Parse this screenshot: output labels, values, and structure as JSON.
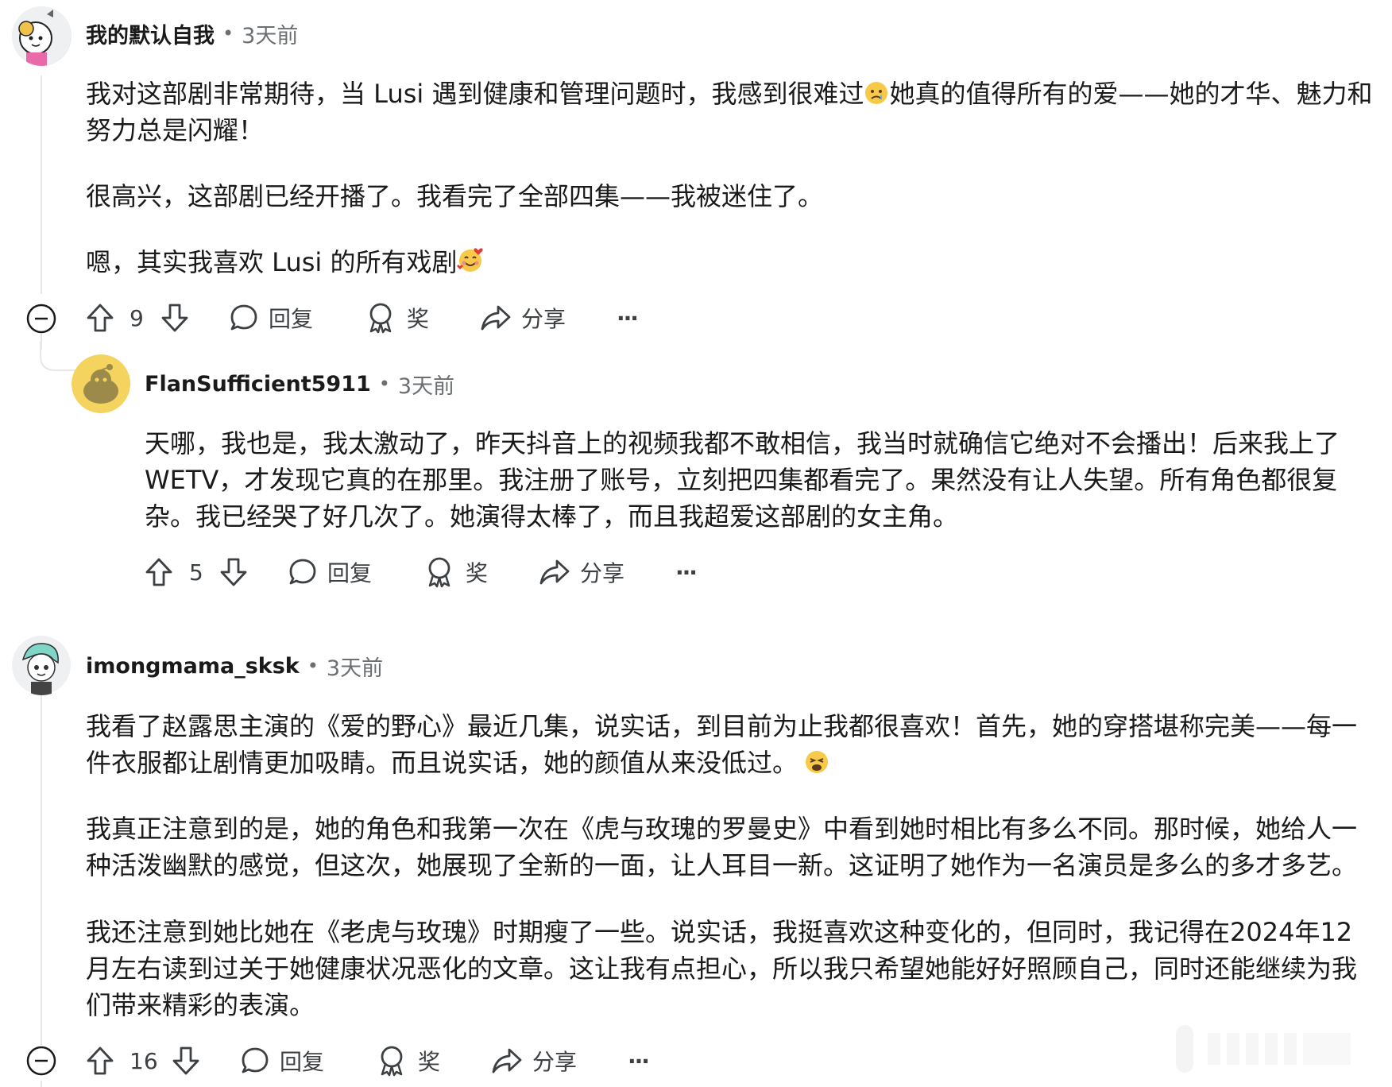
{
  "comments": [
    {
      "username": "我的默认自我",
      "separator": "•",
      "time": "3天前",
      "paragraphs": [
        [
          "我对这部剧非常期待，当 Lusi 遇到健康和管理问题时，我感到很难过",
          "她真的值得所有的爱——她的才华、魅力和"
        ],
        [
          "努力总是闪耀！"
        ],
        [
          "很高兴，这部剧已经开播了。我看完了全部四集——我被迷住了。"
        ],
        [
          "嗯，其实我喜欢 Lusi 的所有戏剧"
        ]
      ],
      "emojis": [
        "crying-face-emoji",
        "smiling-face-with-hearts-emoji"
      ],
      "votes": "9",
      "actions": {
        "reply": "回复",
        "award": "奖",
        "share": "分享",
        "more": "···"
      }
    },
    {
      "username": "FlanSufficient5911",
      "separator": "•",
      "time": "3天前",
      "paragraphs": [
        [
          "天哪，我也是，我太激动了，昨天抖音上的视频我都不敢相信，我当时就确信它绝对不会播出！后来我上了"
        ],
        [
          "WETV，才发现它真的在那里。我注册了账号，立刻把四集都看完了。果然没有让人失望。所有角色都很复"
        ],
        [
          "杂。我已经哭了好几次了。她演得太棒了，而且我超爱这部剧的女主角。"
        ]
      ],
      "votes": "5",
      "actions": {
        "reply": "回复",
        "award": "奖",
        "share": "分享",
        "more": "···"
      }
    },
    {
      "username": "imongmama_sksk",
      "separator": "•",
      "time": "3天前",
      "paragraphs": [
        [
          "我看了赵露思主演的《爱的野心》最近几集，说实话，到目前为止我都很喜欢！首先，她的穿搭堪称完美——每一"
        ],
        [
          "件衣服都让剧情更加吸睛。而且说实话，她的颜值从来没低过。"
        ],
        [
          "我真正注意到的是，她的角色和我第一次在《虎与玫瑰的罗曼史》中看到她时相比有多么不同。那时候，她给人一"
        ],
        [
          "种活泼幽默的感觉，但这次，她展现了全新的一面，让人耳目一新。这证明了她作为一名演员是多么的多才多艺。"
        ],
        [
          "我还注意到她比她在《老虎与玫瑰》时期瘦了一些。说实话，我挺喜欢这种变化的，但同时，我记得在2024年12"
        ],
        [
          "月左右读到过关于她健康状况恶化的文章。这让我有点担心，所以我只希望她能好好照顾自己，同时还能继续为我"
        ],
        [
          "们带来精彩的表演。"
        ]
      ],
      "emojis": [
        "weary-face-emoji"
      ],
      "votes": "16",
      "actions": {
        "reply": "回复",
        "award": "奖",
        "share": "分享",
        "more": "···"
      }
    }
  ],
  "colors": {
    "text": "#1a1a1b",
    "meta": "#6b6f72",
    "icon": "#3c4043",
    "thread_line": "#e5e7ea"
  }
}
